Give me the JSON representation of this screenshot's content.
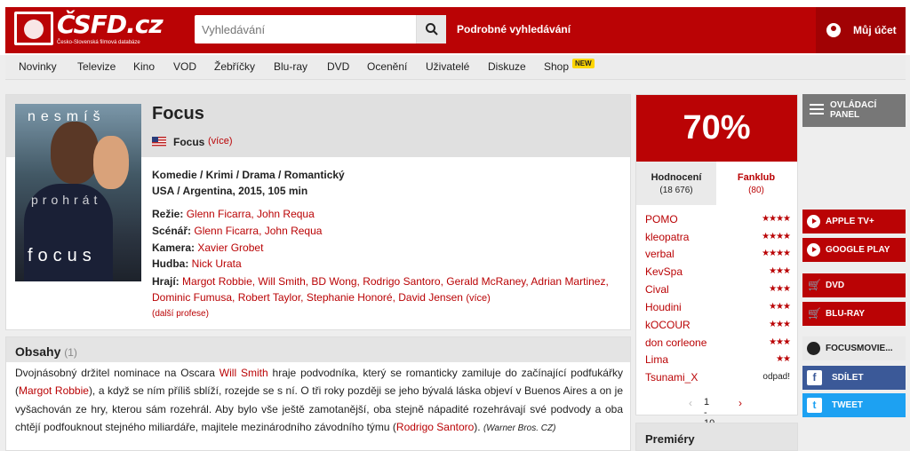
{
  "header": {
    "logo_text": "ČSFD.cz",
    "logo_subtitle": "Česko-Slovenská filmová databáze",
    "search_placeholder": "Vyhledávání",
    "advanced_search": "Podrobné vyhledávání",
    "account": "Můj účet"
  },
  "nav": {
    "items": [
      "Novinky",
      "Televize",
      "Kino",
      "VOD",
      "Žebříčky",
      "Blu-ray",
      "DVD",
      "Ocenění",
      "Uživatelé",
      "Diskuze",
      "Shop"
    ],
    "new_badge": "NEW"
  },
  "film": {
    "poster_text": [
      "nesmíš",
      "prohrát",
      "focus"
    ],
    "title": "Focus",
    "alt_name": "Focus",
    "alt_more": "(více)",
    "genres": "Komedie / Krimi / Drama / Romantický",
    "origin": "USA / Argentina, 2015, 105 min",
    "credits": [
      {
        "label": "Režie:",
        "value": "Glenn Ficarra, John Requa"
      },
      {
        "label": "Scénář:",
        "value": "Glenn Ficarra, John Requa"
      },
      {
        "label": "Kamera:",
        "value": "Xavier Grobet"
      },
      {
        "label": "Hudba:",
        "value": "Nick Urata"
      }
    ],
    "cast_label": "Hrají:",
    "cast": "Margot Robbie, Will Smith, BD Wong, Rodrigo Santoro, Gerald McRaney, Adrian Martinez, Dominic Fumusa, Robert Taylor, Stephanie Honoré, David Jensen",
    "cast_more": "(více)",
    "more_professions": "(další profese)"
  },
  "plot": {
    "title": "Obsahy",
    "count": "(1)",
    "p1": "Dvojnásobný držitel nominace na Oscara ",
    "l1": "Will Smith",
    "p2": " hraje podvodníka, který se romanticky zamiluje do začínající podfukářky (",
    "l2": "Margot Robbie",
    "p3": "), a když se ním příliš sblíží, rozejde se s ní. O tři roky později se jeho bývalá láska objeví v Buenos Aires a on je vyšachován ze hry, kterou sám rozehrál. Aby bylo vše ještě zamotanější, oba stejně nápadité rozehrávají své podvody a oba chtějí podfouknout stejného miliardáře, majitele mezinárodního závodního týmu (",
    "l3": "Rodrigo Santoro",
    "p4": "). ",
    "source": "(Warner Bros. CZ)"
  },
  "rating": {
    "percent": "70%",
    "tab_ratings": "Hodnocení",
    "tab_ratings_count": "(18 676)",
    "tab_fanclub": "Fanklub",
    "tab_fanclub_count": "(80)",
    "users": [
      {
        "name": "POMO",
        "stars": "★★★★"
      },
      {
        "name": "kleopatra",
        "stars": "★★★★"
      },
      {
        "name": "verbal",
        "stars": "★★★★"
      },
      {
        "name": "KevSpa",
        "stars": "★★★"
      },
      {
        "name": "Cival",
        "stars": "★★★"
      },
      {
        "name": "Houdini",
        "stars": "★★★"
      },
      {
        "name": "kOCOUR",
        "stars": "★★★"
      },
      {
        "name": "don corleone",
        "stars": "★★★"
      },
      {
        "name": "Lima",
        "stars": "★★"
      },
      {
        "name": "Tsunami_X",
        "stars": "odpad!"
      }
    ],
    "pager": "1 - 10",
    "pager_prev": "‹",
    "pager_next": "›"
  },
  "premiery": "Premiéry",
  "sidebar": {
    "control_panel": "OVLÁDACÍ PANEL",
    "apple_tv": "APPLE TV+",
    "google_play": "GOOGLE PLAY",
    "dvd": "DVD",
    "bluray": "BLU-RAY",
    "website": "FOCUSMOVIE...",
    "share": "SDÍLET",
    "tweet": "TWEET"
  },
  "colors": {
    "brand": "#ba0305",
    "facebook": "#3b5998",
    "twitter": "#1da1f2"
  }
}
